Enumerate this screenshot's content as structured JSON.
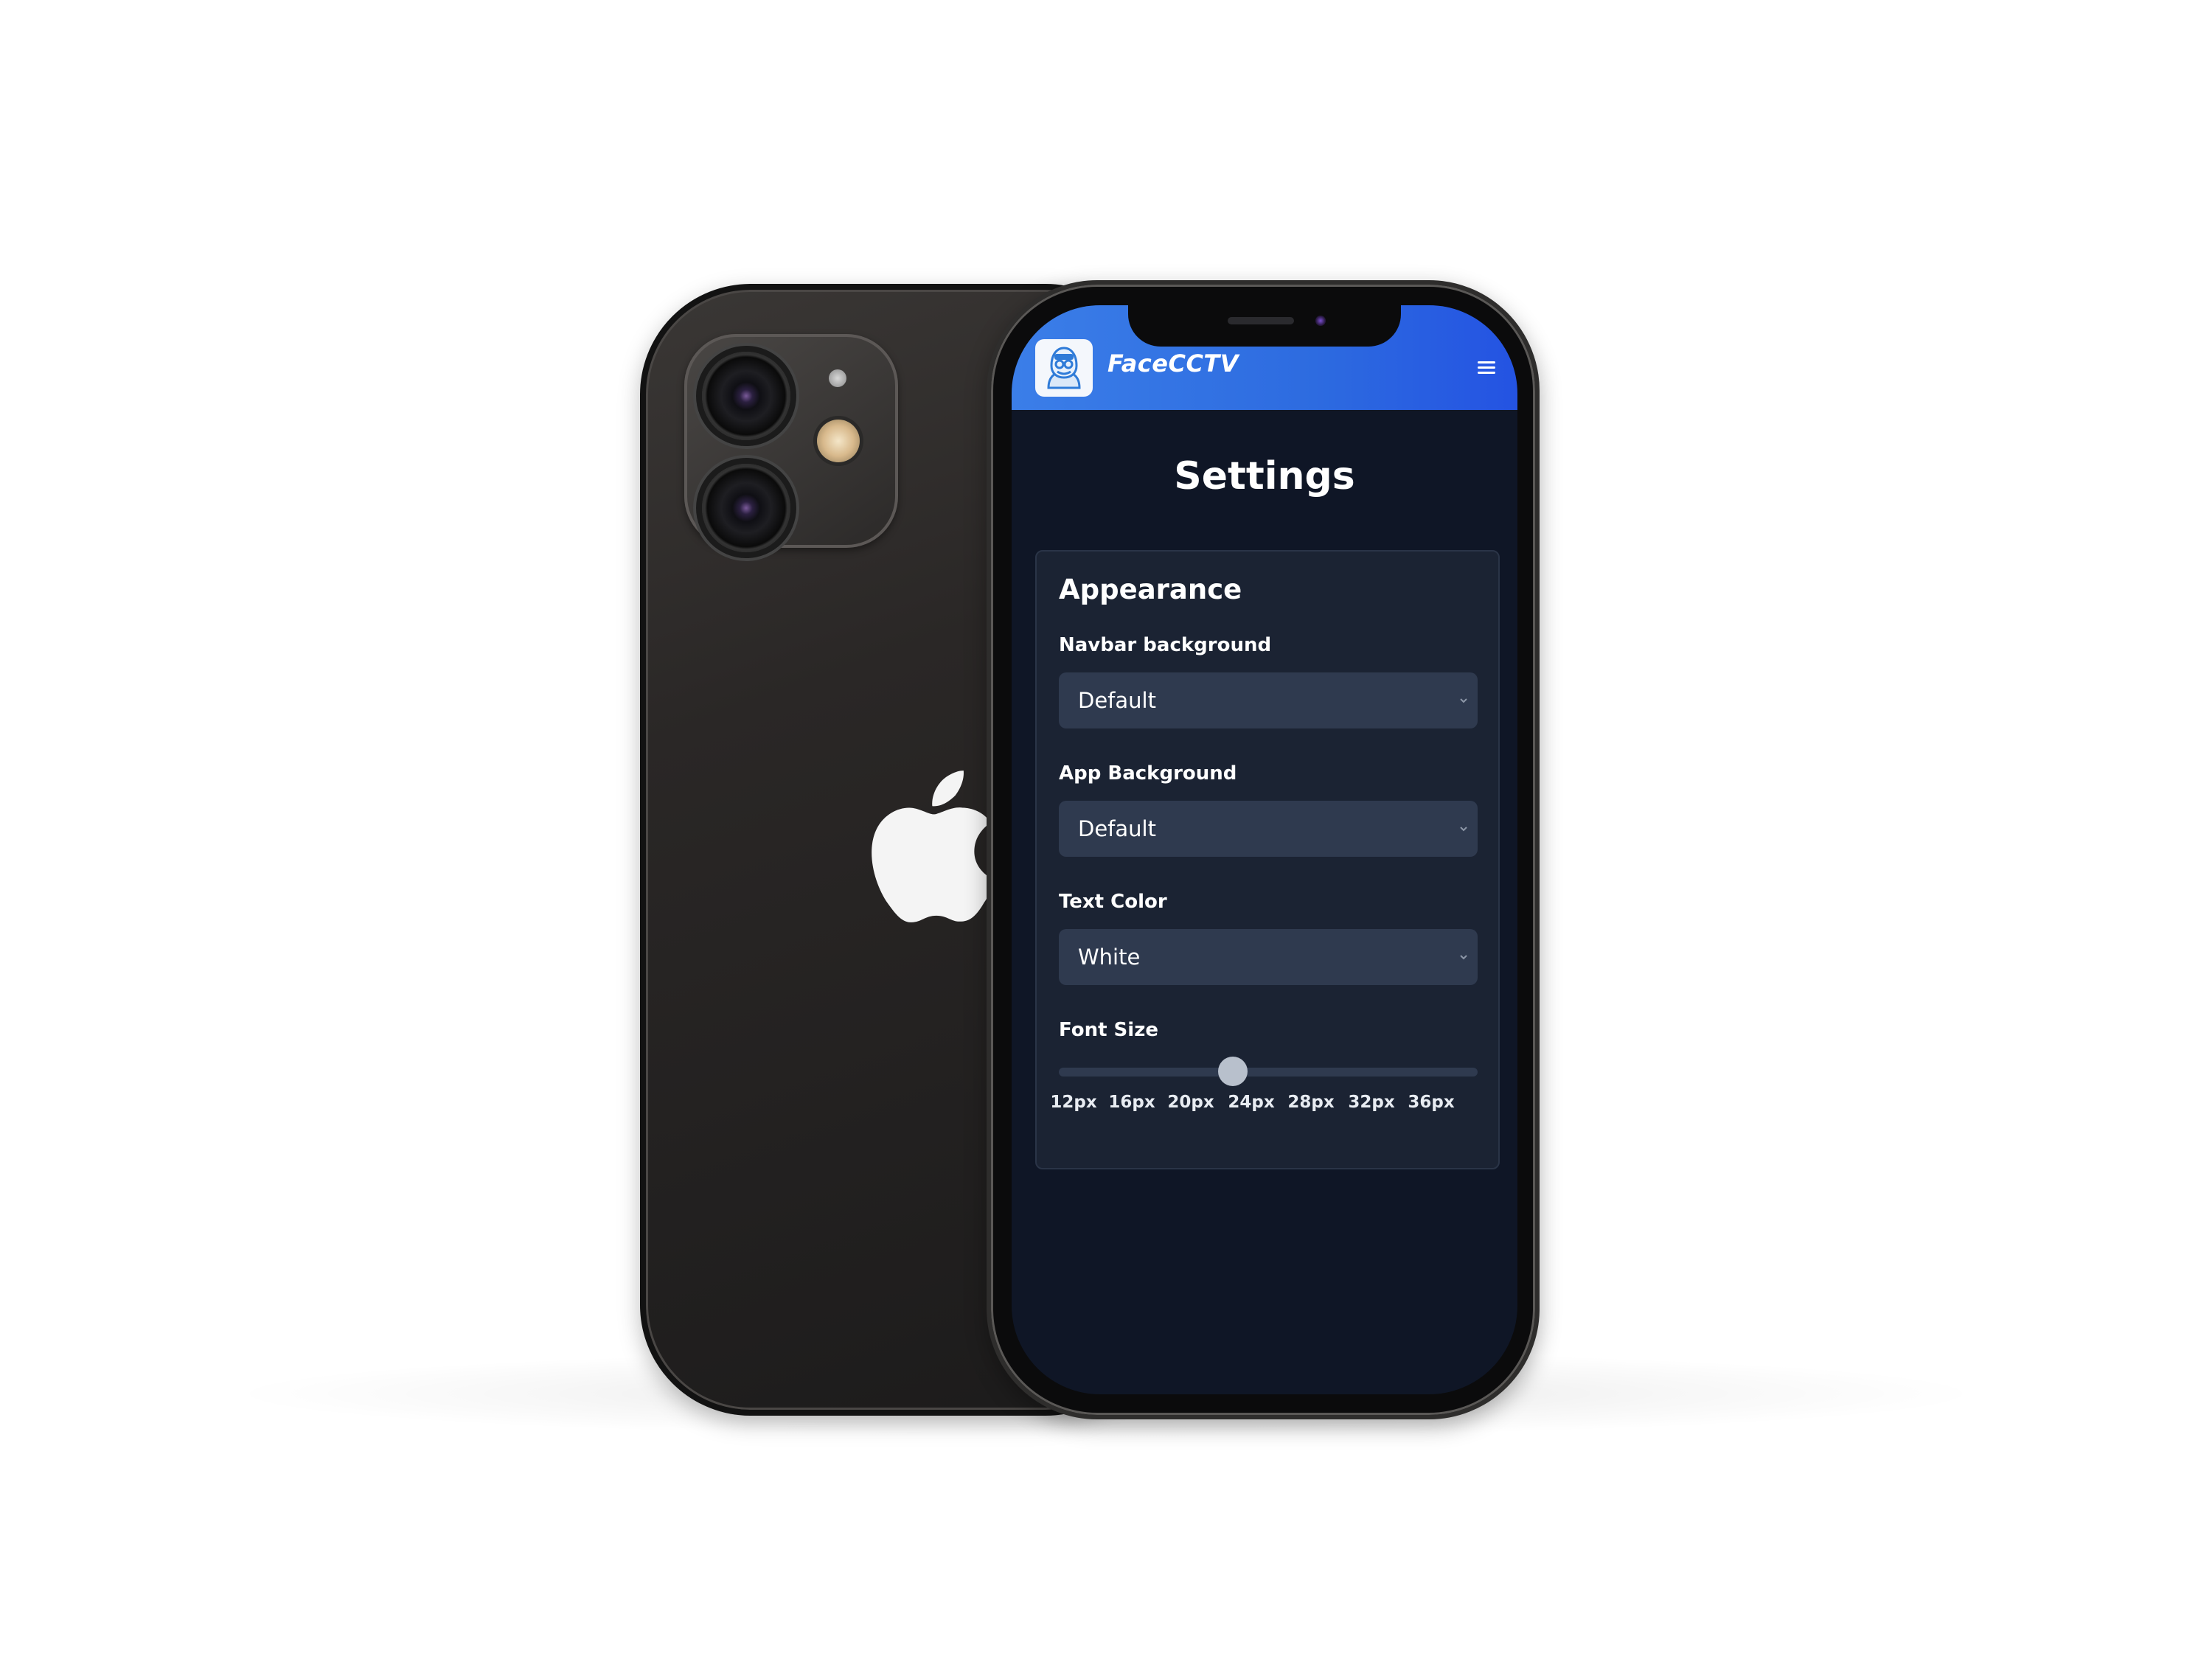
{
  "app": {
    "brand_name": "FaceCCTV"
  },
  "page": {
    "title": "Settings"
  },
  "appearance": {
    "heading": "Appearance",
    "fields": [
      {
        "label": "Navbar background",
        "value": "Default"
      },
      {
        "label": "App Background",
        "value": "Default"
      },
      {
        "label": "Text Color",
        "value": "White"
      }
    ],
    "font_size": {
      "label": "Font Size",
      "options": [
        "12px",
        "16px",
        "20px",
        "24px",
        "28px",
        "32px",
        "36px"
      ],
      "selected": "24px",
      "selected_index": 3
    }
  },
  "colors": {
    "navbar_gradient_start": "#3b7ee8",
    "navbar_gradient_end": "#2453e2",
    "app_background": "#0f1626",
    "card_background": "#1b2333",
    "select_background": "#2f3a4f",
    "text": "#ffffff"
  },
  "icons": {
    "logo": "hooded-figure-avatar-icon",
    "menu": "hamburger-menu-icon",
    "select_arrow": "chevron-down-icon",
    "device_brand": "apple-logo-icon"
  }
}
